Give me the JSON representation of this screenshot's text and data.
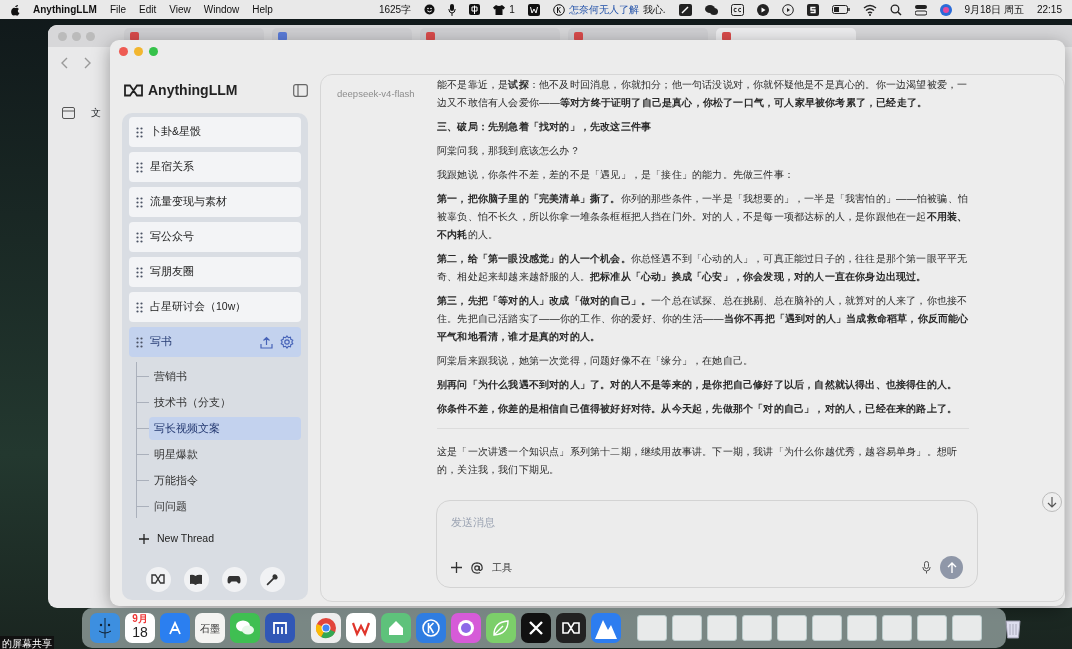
{
  "menu_bar": {
    "app_name": "AnythingLLM",
    "menus": [
      "File",
      "Edit",
      "View",
      "Window",
      "Help"
    ],
    "word_count": "1625字",
    "badge_count": "1",
    "lyric": "怎奈何无人了解",
    "lyric_tail": "我心.",
    "date": "9月18日 周五",
    "time": "22:15"
  },
  "background_window": {
    "tabs": [
      {
        "selected": false
      },
      {
        "selected": false
      },
      {
        "selected": false
      },
      {
        "selected": false
      },
      {
        "selected": true
      }
    ],
    "sidebar_label": "文"
  },
  "app": {
    "brand": "AnythingLLM",
    "workspaces": [
      {
        "name": "卜卦&星骰",
        "selected": false
      },
      {
        "name": "星宿关系",
        "selected": false
      },
      {
        "name": "流量变现与素材",
        "selected": false
      },
      {
        "name": "写公众号",
        "selected": false
      },
      {
        "name": "写朋友圈",
        "selected": false
      },
      {
        "name": "占星研讨会（10w）",
        "selected": false
      },
      {
        "name": "写书",
        "selected": true,
        "threads": [
          {
            "name": "营销书",
            "selected": false
          },
          {
            "name": "技术书（分支）",
            "selected": false
          },
          {
            "name": "写长视频文案",
            "selected": true
          },
          {
            "name": "明星爆款",
            "selected": false
          },
          {
            "name": "万能指令",
            "selected": false
          },
          {
            "name": "问问题",
            "selected": false
          }
        ]
      }
    ],
    "new_thread": "New Thread"
  },
  "chat": {
    "model": "deepseek-v4-flash",
    "messages": [
      {
        "paragraphs": [
          {
            "text": "能不是靠近，是**试探**：他不及时回消息，你就扣分；他一句话没说对，你就怀疑他是不是真心的。你一边渴望被爱，一边又不敢信有人会爱你——**等对方终于证明了自己是真心，你松了一口气，可人家早被你考累了，已经走了。**",
            "bold": false
          },
          {
            "text": "三、破局：先别急着「找对的」，先改这三件事",
            "bold": true
          },
          {
            "text": "阿棠问我，那我到底该怎么办？",
            "bold": false
          },
          {
            "text": "我跟她说，你条件不差，差的不是「遇见」，是「接住」的能力。先做三件事：",
            "bold": false
          },
          {
            "text": "**第一，把你脑子里的「完美清单」撕了。**你列的那些条件，一半是「我想要的」，一半是「我害怕的」——怕被骗、怕被辜负、怕不长久，所以你拿一堆条条框框把人挡在门外。对的人，不是每一项都达标的人，是你跟他在一起**不用装、不内耗**的人。",
            "bold": false
          },
          {
            "text": "**第二，给「第一眼没感觉」的人一个机会。**你总怪遇不到「心动的人」，可真正能过日子的，往往是那个第一眼平平无奇、相处起来却越来越舒服的人。**把标准从「心动」换成「心安」，你会发现，对的人一直在你身边出现过。**",
            "bold": false
          },
          {
            "text": "**第三，先把「等对的人」改成「做对的自己」。**一个总在试探、总在挑剔、总在脑补的人，就算对的人来了，你也接不住。先把自己活踏实了——你的工作、你的爱好、你的生活——**当你不再把「遇到对的人」当成救命稻草，你反而能心平气和地看清，谁才是真的对的人。**",
            "bold": false
          },
          {
            "text": "阿棠后来跟我说，她第一次觉得，问题好像不在「缘分」，在她自己。",
            "bold": false
          },
          {
            "text": "别再问「为什么我遇不到对的人」了。对的人不是等来的，是你把自己修好了以后，自然就认得出、也接得住的人。",
            "bold": true
          },
          {
            "text": "你条件不差，你差的是相信自己值得被好好对待。从今天起，先做那个「对的自己」，对的人，已经在来的路上了。",
            "bold": true
          }
        ]
      },
      {
        "paragraphs": [
          {
            "text": "这是「一次讲透一个知识点」系列第十二期，继续用故事讲。下一期，我讲「为什么你越优秀，越容易单身」。想听的，关注我，我们下期见。",
            "bold": false
          }
        ]
      }
    ],
    "input": {
      "placeholder": "发送消息",
      "tools_label": "工具"
    }
  },
  "dock": {
    "calendar_month": "9月",
    "calendar_day": "18",
    "doc_app_label": "石墨"
  },
  "screen_share_label": "的屏幕共享"
}
